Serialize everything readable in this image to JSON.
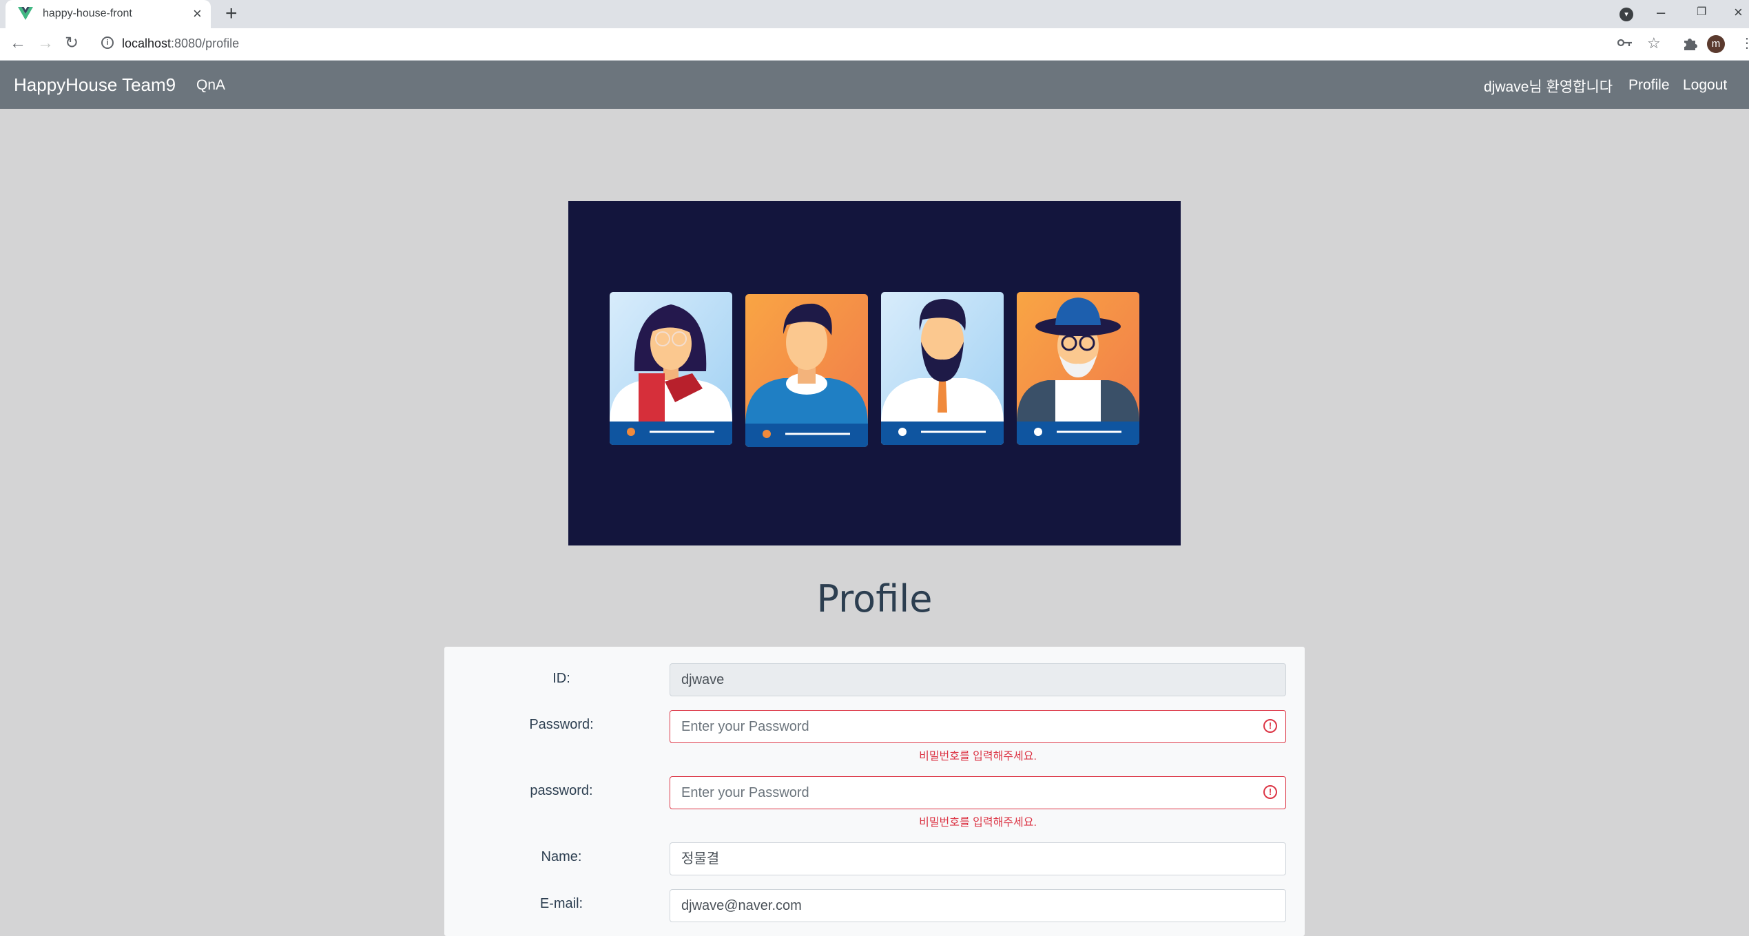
{
  "browser": {
    "tab_title": "happy-house-front",
    "url_host": "localhost",
    "url_path": ":8080/profile",
    "profile_initial": "m"
  },
  "navbar": {
    "brand": "HappyHouse Team9",
    "links": [
      "QnA"
    ],
    "welcome": "djwave님 환영합니다",
    "profile": "Profile",
    "logout": "Logout"
  },
  "page": {
    "title": "Profile"
  },
  "form": {
    "id_label": "ID:",
    "id_value": "djwave",
    "password_label": "Password:",
    "password_placeholder": "Enter your Password",
    "password_error": "비밀번호를 입력해주세요.",
    "password_confirm_label": "password:",
    "password_confirm_placeholder": "Enter your Password",
    "password_confirm_error": "비밀번호를 입력해주세요.",
    "name_label": "Name:",
    "name_value": "정물결",
    "email_label": "E-mail:",
    "email_value": "djwave@naver.com"
  },
  "colors": {
    "navbar_bg": "#6c757d",
    "page_bg": "#d4d4d5",
    "hero_bg": "#13153d",
    "error": "#dc3545",
    "title": "#2c3e50"
  }
}
